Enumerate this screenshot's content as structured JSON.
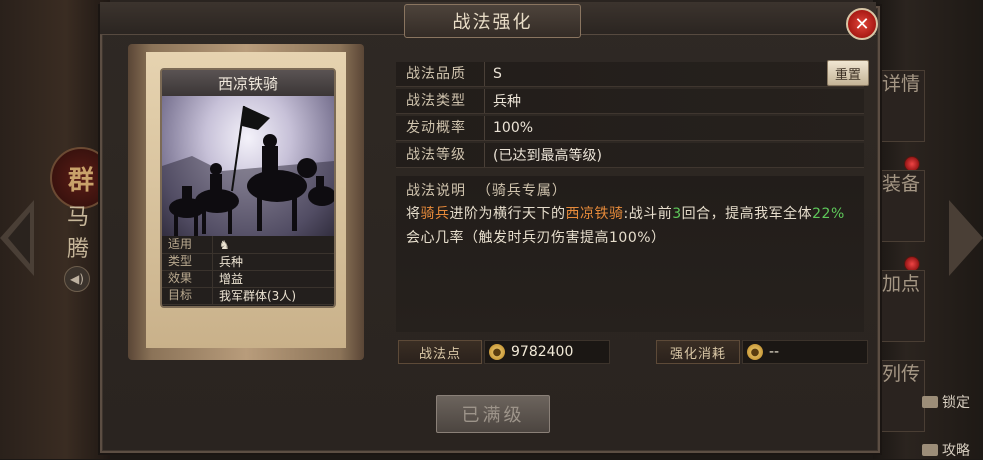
{
  "background": {
    "left_emblem": "群",
    "left_name": "马腾",
    "sound_icon": "speaker-icon",
    "side_tabs": [
      "详情",
      "装备",
      "加点",
      "列传"
    ],
    "right_links": [
      "锁定",
      "攻略"
    ]
  },
  "dialog": {
    "title": "战法强化",
    "close_icon": "close-icon"
  },
  "card": {
    "name": "西凉铁骑",
    "rows": [
      {
        "key": "适用",
        "value": "♞"
      },
      {
        "key": "类型",
        "value": "兵种"
      },
      {
        "key": "效果",
        "value": "增益"
      },
      {
        "key": "目标",
        "value": "我军群体(3人)"
      }
    ]
  },
  "fields": [
    {
      "key": "战法品质",
      "value": "S"
    },
    {
      "key": "战法类型",
      "value": "兵种"
    },
    {
      "key": "发动概率",
      "value": "100%"
    },
    {
      "key": "战法等级",
      "value": "(已达到最高等级)"
    }
  ],
  "reset_label": "重置",
  "description": {
    "label": "战法说明",
    "tag": "（骑兵专属）",
    "parts": [
      {
        "text": "将",
        "style": "normal"
      },
      {
        "text": "骑兵",
        "style": "orange"
      },
      {
        "text": "进阶为横行天下的",
        "style": "normal"
      },
      {
        "text": "西凉铁骑",
        "style": "orange"
      },
      {
        "text": ":战斗前",
        "style": "normal"
      },
      {
        "text": "3",
        "style": "green"
      },
      {
        "text": "回合，提高我军全体",
        "style": "normal"
      },
      {
        "text": "22%",
        "style": "green"
      },
      {
        "text": "会心几率（触发时兵刃伤害提高100%）",
        "style": "normal"
      }
    ]
  },
  "points": {
    "label": "战法点",
    "value": "9782400"
  },
  "cost": {
    "label": "强化消耗",
    "value": "--"
  },
  "max_button": "已满级",
  "colors": {
    "highlight_orange": "#e68a3a",
    "highlight_green": "#5ec85a",
    "close_red": "#c42a20"
  }
}
